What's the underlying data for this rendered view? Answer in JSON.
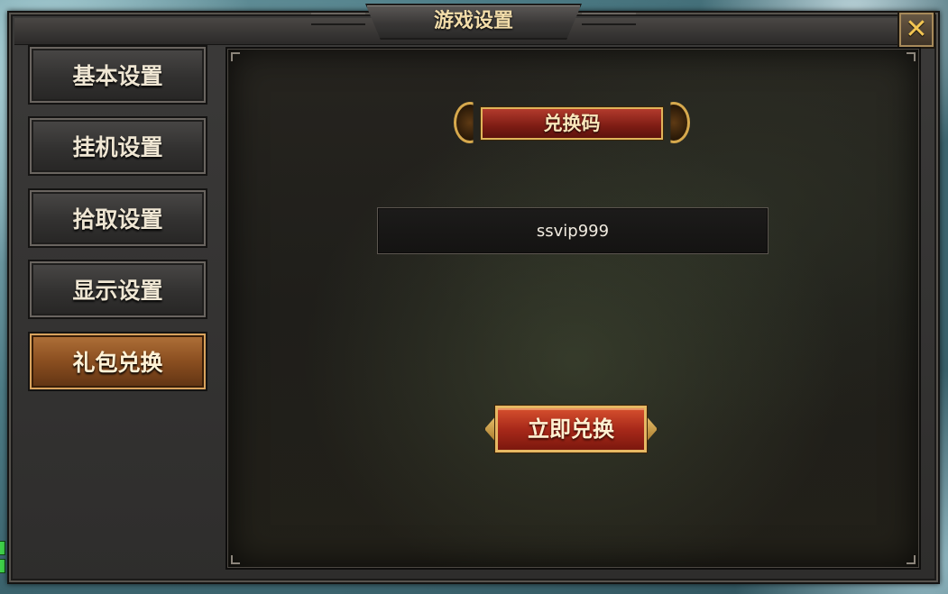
{
  "window": {
    "title": "游戏设置",
    "close_icon": "close-icon"
  },
  "sidebar": {
    "items": [
      {
        "label": "基本设置",
        "active": false
      },
      {
        "label": "挂机设置",
        "active": false
      },
      {
        "label": "拾取设置",
        "active": false
      },
      {
        "label": "显示设置",
        "active": false
      },
      {
        "label": "礼包兑换",
        "active": true
      }
    ]
  },
  "main": {
    "section_title": "兑换码",
    "code_input": {
      "value": "ssvip999",
      "placeholder": ""
    },
    "redeem_button_label": "立即兑换"
  },
  "colors": {
    "title_text": "#f3ddaa",
    "active_tab": "#8a4e20",
    "banner_red": "#7d1c14",
    "gold_trim": "#e0b45a"
  }
}
